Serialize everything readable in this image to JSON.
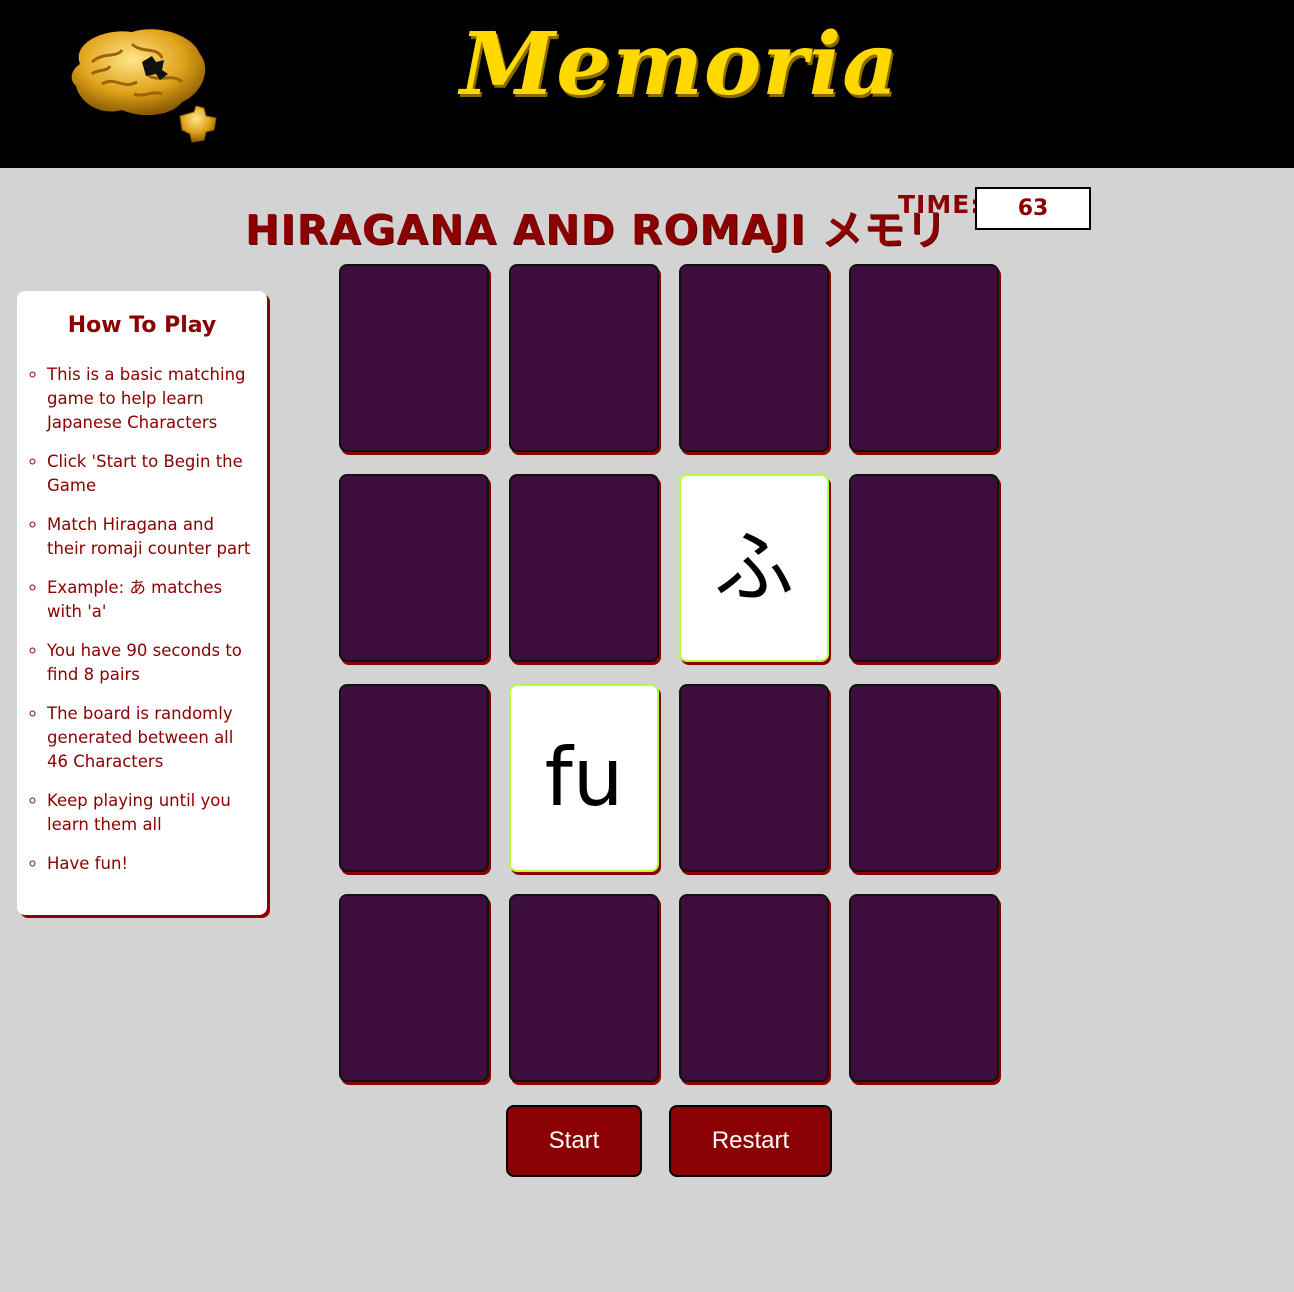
{
  "header": {
    "brand": "Memoria",
    "logo_icon": "brain-puzzle-icon"
  },
  "game": {
    "title": "HIRAGANA AND ROMAJI メモリ",
    "time_label": "TIME:",
    "time_value": "63"
  },
  "howto": {
    "heading": "How To Play",
    "items": [
      "This is a basic matching game to help learn Japanese Characters",
      "Click 'Start to Begin the Game",
      "Match Hiragana and their romaji counter part",
      "Example: あ matches with 'a'",
      "You have 90 seconds to find 8 pairs",
      "The board is randomly generated between all 46 Characters",
      "Keep playing until you learn them all",
      "Have fun!"
    ]
  },
  "board": {
    "rows": 4,
    "cols": 4,
    "cards": [
      {
        "state": "hidden"
      },
      {
        "state": "hidden"
      },
      {
        "state": "hidden"
      },
      {
        "state": "hidden"
      },
      {
        "state": "hidden"
      },
      {
        "state": "hidden"
      },
      {
        "state": "open",
        "face": "ふ"
      },
      {
        "state": "hidden"
      },
      {
        "state": "hidden"
      },
      {
        "state": "open",
        "face": "fu"
      },
      {
        "state": "hidden"
      },
      {
        "state": "hidden"
      },
      {
        "state": "hidden"
      },
      {
        "state": "hidden"
      },
      {
        "state": "hidden"
      },
      {
        "state": "hidden"
      }
    ]
  },
  "controls": {
    "start_label": "Start",
    "restart_label": "Restart"
  },
  "colors": {
    "header_bg": "#000000",
    "brand": "#ffd800",
    "accent": "#8b0000",
    "card_back": "#3d0e3d",
    "card_open_border": "#b3ff3a",
    "page_bg": "#d3d3d3"
  }
}
